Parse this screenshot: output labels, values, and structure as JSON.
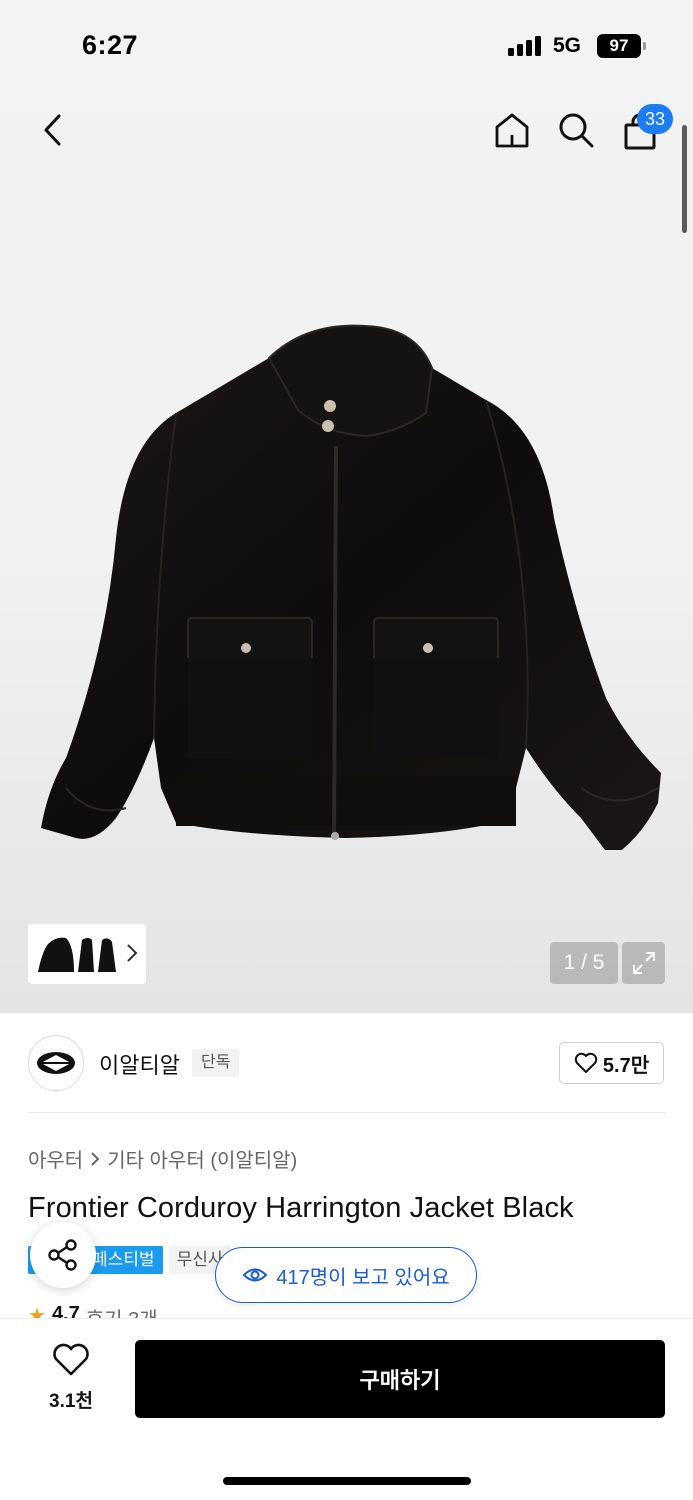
{
  "status_bar": {
    "time": "6:27",
    "network": "5G",
    "battery": "97"
  },
  "nav": {
    "cart_count": "33",
    "icons": [
      "back-icon",
      "home-icon",
      "search-icon",
      "cart-icon"
    ]
  },
  "gallery": {
    "page_counter": "1 / 5"
  },
  "brand": {
    "name": "이알티알",
    "tag": "단독",
    "likes": "5.7만"
  },
  "breadcrumb": {
    "category": "아우터",
    "subcategory": "기타 아우터 (이알티알)"
  },
  "product": {
    "title": "Frontier Corduroy Harrington Jacket Black"
  },
  "badges": {
    "festival": "페스티벌",
    "musinsa": "무신사"
  },
  "viewers": {
    "text": "417명이 보고 있어요"
  },
  "rating": {
    "score": "4.7",
    "reviews": "후기 3개"
  },
  "bottom": {
    "wish_count": "3.1천",
    "buy_label": "구매하기"
  },
  "colors": {
    "accent_blue": "#1a5bd8",
    "badge_blue": "#1a9bf0",
    "cart_badge": "#1a7df5",
    "buy_button": "#000000"
  }
}
